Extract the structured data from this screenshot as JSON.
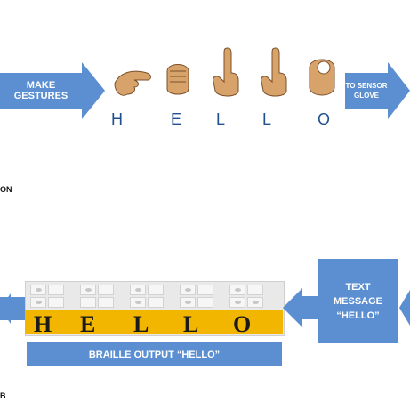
{
  "diagram": {
    "top": {
      "input_label": "MAKE GESTURES",
      "output_label_line1": "TO SENSOR",
      "output_label_line2": "GLOVE",
      "letters": [
        "H",
        "E",
        "L",
        "L",
        "O"
      ],
      "caption_fragment": "ON"
    },
    "bottom": {
      "text_message_line1": "TEXT",
      "text_message_line2": "MESSAGE",
      "text_message_line3": "“HELLO”",
      "braille_output_label": "BRAILLE  OUTPUT “HELLO”",
      "braille_letters": [
        "H",
        "E",
        "L",
        "L",
        "O"
      ],
      "caption_fragment": "B"
    },
    "colors": {
      "arrow_blue": "#5b8fd1",
      "letter_blue": "#1f4f8f",
      "braille_yellow": "#f2b600",
      "hand_skin": "#d8a36a"
    },
    "icons": [
      "hand-h-icon",
      "hand-e-icon",
      "hand-l1-icon",
      "hand-l2-icon",
      "hand-o-icon"
    ]
  }
}
